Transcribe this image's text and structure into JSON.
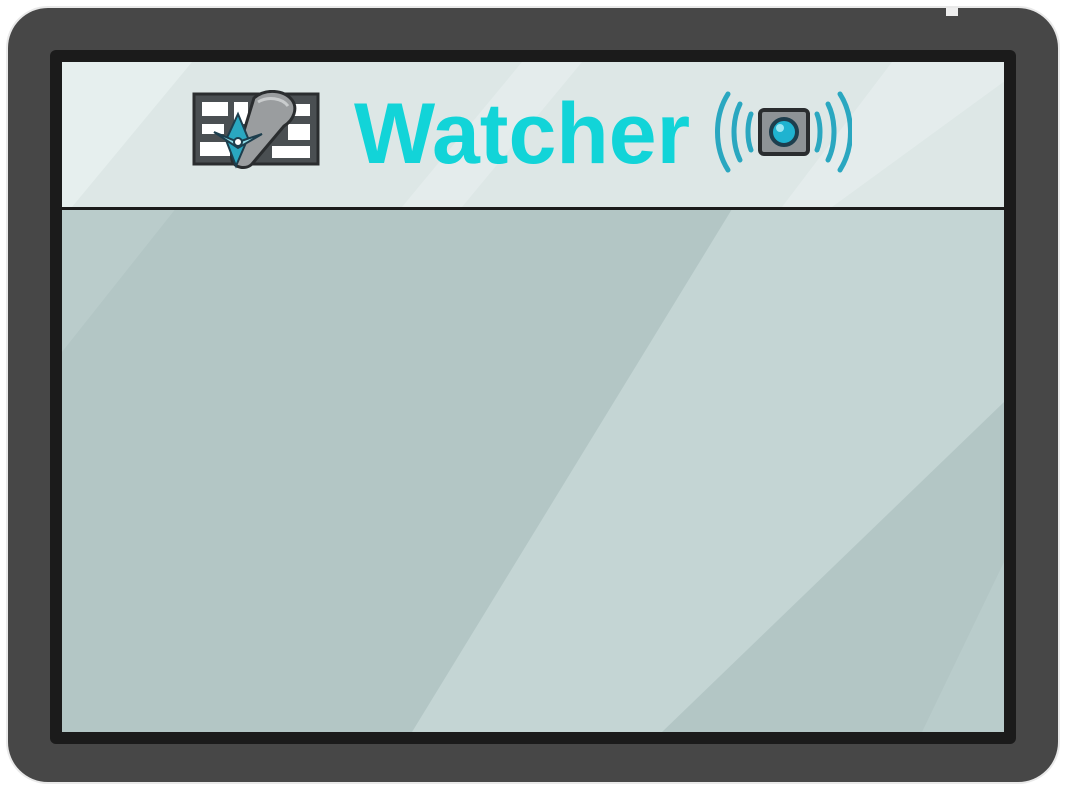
{
  "app": {
    "title": "Watcher"
  },
  "header": {
    "left_icon": "map-compass-icon",
    "right_icon": "broadcast-camera-icon"
  },
  "colors": {
    "device_frame": "#474747",
    "bezel": "#1b1b1b",
    "screen": "#b3c6c5",
    "header_background": "#dde7e6",
    "title": "#12d4d8",
    "icon_accent": "#2aa7c0"
  }
}
